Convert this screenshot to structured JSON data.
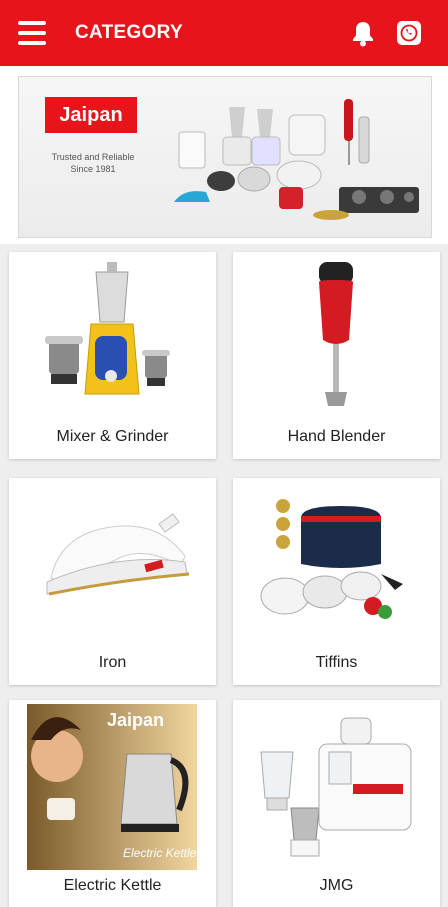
{
  "header": {
    "title": "CATEGORY",
    "menu_icon": "menu-icon",
    "notification_icon": "bell-icon",
    "whatsapp_icon": "whatsapp-icon"
  },
  "banner": {
    "brand": "Jaipan",
    "tagline": "Trusted and Reliable Since 1981"
  },
  "categories": [
    {
      "label": "Mixer & Grinder"
    },
    {
      "label": "Hand Blender"
    },
    {
      "label": "Iron"
    },
    {
      "label": "Tiffins"
    },
    {
      "label": "Electric Kettle",
      "promo_brand": "Jaipan",
      "promo_text": "Electric Kettle"
    },
    {
      "label": "JMG"
    }
  ],
  "colors": {
    "primary": "#e8141c",
    "background": "#eeeeee",
    "card": "#ffffff"
  }
}
